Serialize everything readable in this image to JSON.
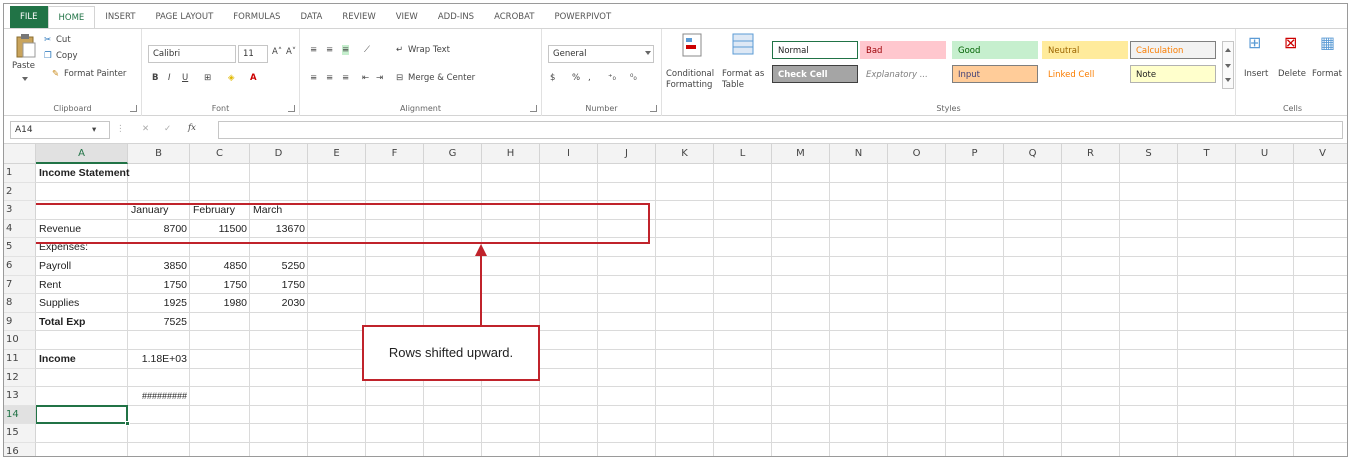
{
  "ribbon_tabs": [
    "FILE",
    "HOME",
    "INSERT",
    "PAGE LAYOUT",
    "FORMULAS",
    "DATA",
    "REVIEW",
    "VIEW",
    "ADD-INS",
    "ACROBAT",
    "POWERPIVOT"
  ],
  "active_tab": "HOME",
  "clipboard": {
    "paste": "Paste",
    "cut": "Cut",
    "copy": "Copy",
    "format_painter": "Format Painter",
    "label": "Clipboard"
  },
  "font": {
    "name": "Calibri",
    "size": "11",
    "label": "Font"
  },
  "alignment": {
    "wrap_text": "Wrap Text",
    "merge_center": "Merge & Center",
    "label": "Alignment"
  },
  "number": {
    "format": "General",
    "currency": "$",
    "percent": "%",
    "comma": ",",
    "label": "Number"
  },
  "styles": {
    "conditional_formatting": "Conditional Formatting",
    "format_as_table": "Format as Table",
    "label": "Styles",
    "cells": [
      {
        "text": "Normal",
        "bg": "#ffffff",
        "fg": "#222222",
        "border": "#217346"
      },
      {
        "text": "Bad",
        "bg": "#ffc7ce",
        "fg": "#9c0006",
        "border": "#ffc7ce"
      },
      {
        "text": "Good",
        "bg": "#c6efce",
        "fg": "#006100",
        "border": "#c6efce"
      },
      {
        "text": "Neutral",
        "bg": "#ffeb9c",
        "fg": "#9c6500",
        "border": "#ffeb9c"
      },
      {
        "text": "Calculation",
        "bg": "#f2f2f2",
        "fg": "#fa7d00",
        "border": "#7f7f7f"
      },
      {
        "text": "Check Cell",
        "bg": "#a5a5a5",
        "fg": "#ffffff",
        "border": "#3f3f3f"
      },
      {
        "text": "Explanatory ...",
        "bg": "#ffffff",
        "fg": "#7f7f7f",
        "border": "#ffffff"
      },
      {
        "text": "Input",
        "bg": "#ffcc99",
        "fg": "#3f3f76",
        "border": "#7f7f7f"
      },
      {
        "text": "Linked Cell",
        "bg": "#ffffff",
        "fg": "#fa7d00",
        "border": "#ffffff"
      },
      {
        "text": "Note",
        "bg": "#ffffcc",
        "fg": "#222222",
        "border": "#b2b2b2"
      }
    ]
  },
  "cells_group": {
    "insert": "Insert",
    "delete": "Delete",
    "format": "Format",
    "label": "Cells"
  },
  "formula_bar": {
    "name_box": "A14",
    "fx": "fx",
    "value": ""
  },
  "columns": [
    "A",
    "B",
    "C",
    "D",
    "E",
    "F",
    "G",
    "H",
    "I",
    "J",
    "K",
    "L",
    "M",
    "N",
    "O",
    "P",
    "Q",
    "R",
    "S",
    "T",
    "U",
    "V"
  ],
  "rows": [
    "1",
    "2",
    "3",
    "4",
    "5",
    "6",
    "7",
    "8",
    "9",
    "10",
    "11",
    "12",
    "13",
    "14",
    "15",
    "16"
  ],
  "selected_cell": {
    "col": "A",
    "row": "14"
  },
  "sheet": {
    "A1": "Income Statement",
    "B3": "January",
    "C3": "February",
    "D3": "March",
    "A4": "Revenue",
    "B4": "8700",
    "C4": "11500",
    "D4": "13670",
    "A5": "Expenses:",
    "A6": "Payroll",
    "B6": "3850",
    "C6": "4850",
    "D6": "5250",
    "A7": "Rent",
    "B7": "1750",
    "C7": "1750",
    "D7": "1750",
    "A8": "Supplies",
    "B8": "1925",
    "C8": "1980",
    "D8": "2030",
    "A9": "Total Exp",
    "B9": "7525",
    "A11": "Income",
    "B11": "1.18E+03",
    "B13": "#########"
  },
  "annotation": {
    "text": "Rows shifted upward.",
    "color": "#c0232b"
  }
}
